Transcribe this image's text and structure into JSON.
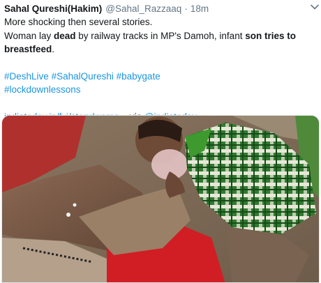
{
  "tweet": {
    "display_name": "Sahal Qureshi(Hakim)",
    "handle": "@Sahal_Razzaaq",
    "separator": "·",
    "time": "18m",
    "line1": "More shocking then several stories.",
    "line2_pre": "Woman lay ",
    "line2_bold1": "dead",
    "line2_mid": " by railway tracks in MP's Damoh, infant ",
    "line2_bold2": "son tries to",
    "line3_bold": "breastfeed",
    "line3_post": ".",
    "hashtags": [
      "#DeshLive",
      "#SahalQureshi",
      "#babygate",
      "#lockdownlessons"
    ],
    "link_text": "indiatoday.in/fyi/story/woma...",
    "via_text": "via",
    "via_handle": "@indiatoday"
  },
  "icons": {
    "caret": "chevron-down-icon"
  },
  "colors": {
    "text": "#14171a",
    "secondary": "#657786",
    "link": "#1b95e0"
  }
}
